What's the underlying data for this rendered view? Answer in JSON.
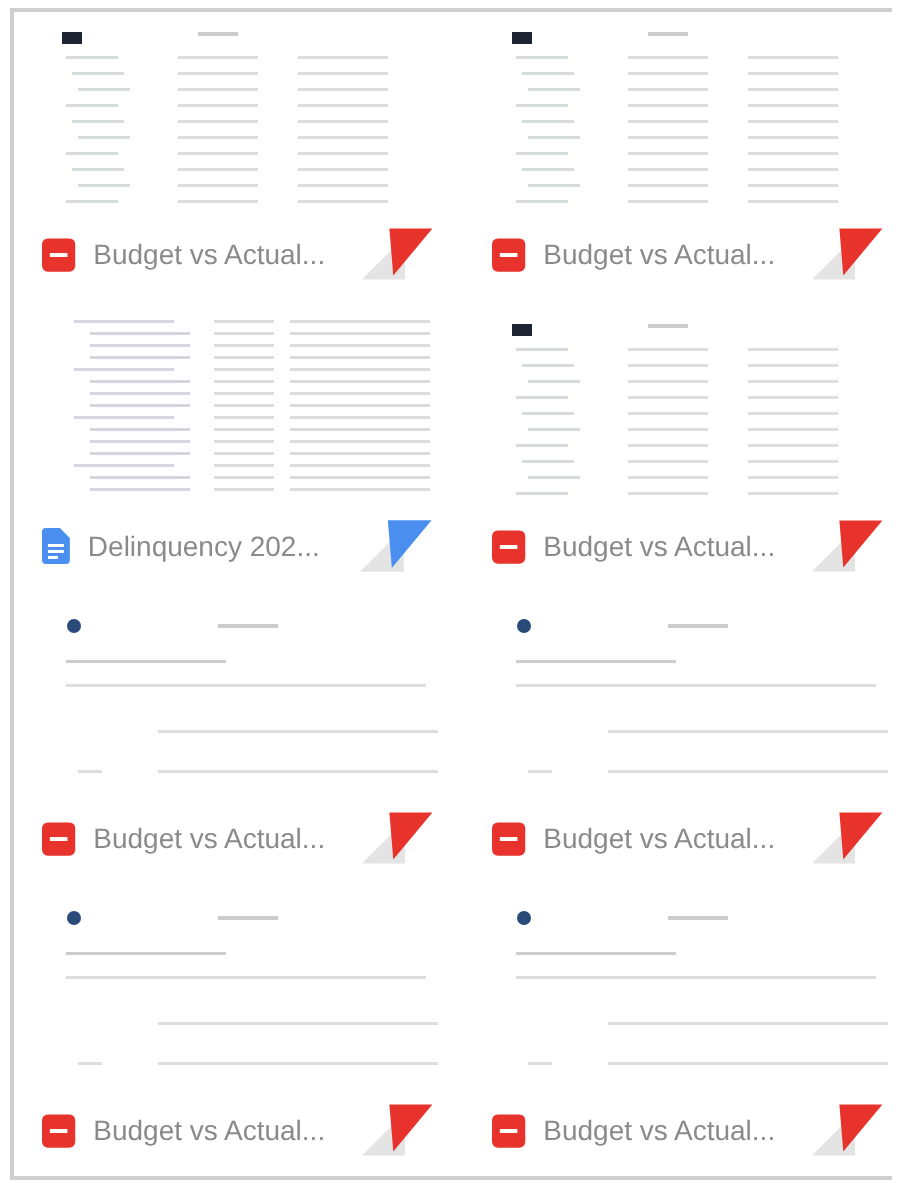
{
  "files": [
    {
      "name": "Budget vs Actual...",
      "kind": "pdf"
    },
    {
      "name": "Budget vs Actual...",
      "kind": "pdf"
    },
    {
      "name": "Delinquency 202...",
      "kind": "doc"
    },
    {
      "name": "Budget vs Actual...",
      "kind": "pdf"
    },
    {
      "name": "Budget vs Actual...",
      "kind": "pdf"
    },
    {
      "name": "Budget vs Actual...",
      "kind": "pdf"
    },
    {
      "name": "Budget vs Actual...",
      "kind": "pdf"
    },
    {
      "name": "Budget vs Actual...",
      "kind": "pdf"
    }
  ]
}
